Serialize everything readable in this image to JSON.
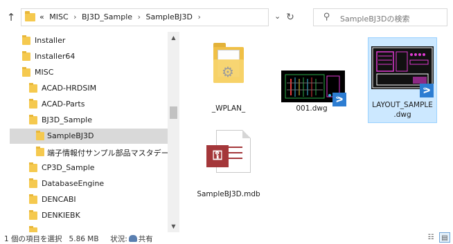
{
  "address": {
    "prefix": "«",
    "crumbs": [
      "MISC",
      "BJ3D_Sample",
      "SampleBJ3D"
    ],
    "separator": "›",
    "dropdown": "⌄",
    "refresh": "↻"
  },
  "nav": {
    "up": "↑"
  },
  "search": {
    "placeholder": "SampleBJ3Dの検索"
  },
  "tree": {
    "items": [
      {
        "label": "Installer",
        "indent": 0
      },
      {
        "label": "Installer64",
        "indent": 0
      },
      {
        "label": "MISC",
        "indent": 0
      },
      {
        "label": "ACAD-HRDSIM",
        "indent": 1
      },
      {
        "label": "ACAD-Parts",
        "indent": 1
      },
      {
        "label": "BJ3D_Sample",
        "indent": 1
      },
      {
        "label": "SampleBJ3D",
        "indent": 2,
        "selected": true
      },
      {
        "label": "端子情報付サンプル部品マスタデータ",
        "indent": 2
      },
      {
        "label": "CP3D_Sample",
        "indent": 1
      },
      {
        "label": "DatabaseEngine",
        "indent": 1
      },
      {
        "label": "DENCABI",
        "indent": 1
      },
      {
        "label": "DENKIEBK",
        "indent": 1
      }
    ]
  },
  "scrollbar": {
    "up": "▲",
    "down": "▼"
  },
  "files": [
    {
      "name": "_WPLAN_",
      "type": "folder"
    },
    {
      "name": "001.dwg",
      "type": "dwg"
    },
    {
      "name_line1": "LAYOUT_SAMPLE",
      "name_line2": ".dwg",
      "type": "dwg",
      "selected": true
    },
    {
      "name": "SampleBJ3D.mdb",
      "type": "mdb"
    }
  ],
  "status": {
    "selection": "1 個の項目を選択",
    "size": "5.86 MB",
    "state_label": "状況:",
    "state_value": "共有"
  },
  "colors": {
    "folder": "#f5c94f",
    "selection": "#cce8ff",
    "tree_selection": "#d9d9d9",
    "badge": "#2d7dd2",
    "access": "#a4373a"
  }
}
